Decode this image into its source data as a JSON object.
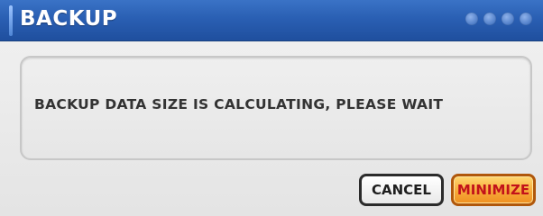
{
  "dialog": {
    "title": "BACKUP",
    "message": "BACKUP DATA SIZE IS CALCULATING, PLEASE WAIT",
    "buttons": {
      "cancel_label": "CANCEL",
      "minimize_label": "MINIMIZE"
    },
    "titlebar_dot_count": 4
  },
  "colors": {
    "titlebar": "#2a5fb3",
    "minimize_button": "#f7a93a",
    "minimize_text": "#c2121a"
  }
}
